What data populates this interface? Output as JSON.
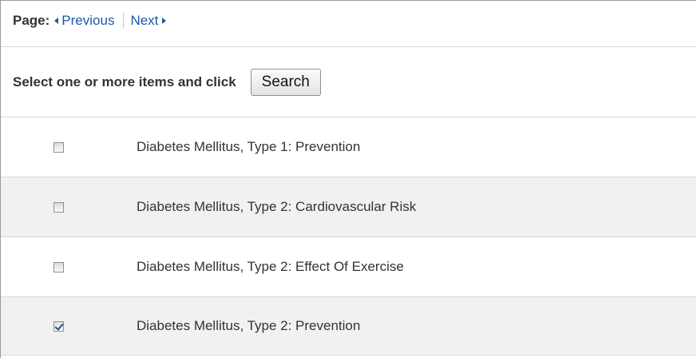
{
  "pager": {
    "label": "Page:",
    "previous": "Previous",
    "next": "Next"
  },
  "action": {
    "instruction": "Select one or more items and click",
    "search_label": "Search"
  },
  "items": [
    {
      "label": "Diabetes Mellitus, Type 1: Prevention",
      "checked": false
    },
    {
      "label": "Diabetes Mellitus, Type 2: Cardiovascular Risk",
      "checked": false
    },
    {
      "label": "Diabetes Mellitus, Type 2: Effect Of Exercise",
      "checked": false
    },
    {
      "label": "Diabetes Mellitus, Type 2: Prevention",
      "checked": true
    }
  ],
  "colors": {
    "link": "#1a5aa8",
    "alt_row": "#f1f1f1",
    "divider": "#d8d8d8"
  }
}
